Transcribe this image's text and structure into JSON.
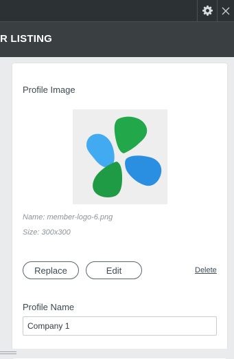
{
  "header": {
    "title": "R LISTING"
  },
  "toolbar": {
    "settings_icon": "gear-icon",
    "close_icon": "close-icon"
  },
  "profile_image": {
    "section_label": "Profile Image",
    "name_text": "Name: member-logo-6.png",
    "size_text": "Size: 300x300",
    "logo_colors": [
      "#42aaf0",
      "#20a04a",
      "#2a8fe0"
    ]
  },
  "actions": {
    "replace_label": "Replace",
    "edit_label": "Edit",
    "delete_label": "Delete"
  },
  "profile_name": {
    "label": "Profile Name",
    "value": "Company 1"
  }
}
